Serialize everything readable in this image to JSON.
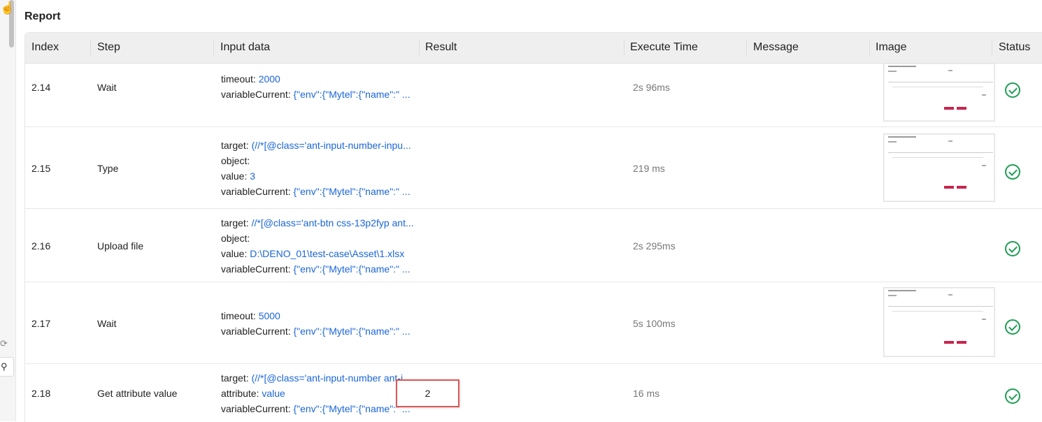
{
  "report_title": "Report",
  "columns": [
    "Index",
    "Step",
    "Input data",
    "Result",
    "Execute Time",
    "Message",
    "Image",
    "Status"
  ],
  "rows": [
    {
      "index": "2.14",
      "step": "Wait",
      "inputs": [
        {
          "key": "timeout:",
          "value": "2000"
        },
        {
          "key": "variableCurrent:",
          "value": "{\"env\":{\"Mytel\":{\"name\":\" ..."
        }
      ],
      "result": "",
      "execute_time": "2s 96ms",
      "message": "",
      "has_image": true,
      "status": "passed"
    },
    {
      "index": "2.15",
      "step": "Type",
      "inputs": [
        {
          "key": "target:",
          "value": "(//*[@class='ant-input-number-inpu..."
        },
        {
          "key": "object:",
          "value": ""
        },
        {
          "key": "value:",
          "value": "3"
        },
        {
          "key": "variableCurrent:",
          "value": "{\"env\":{\"Mytel\":{\"name\":\" ..."
        }
      ],
      "result": "",
      "execute_time": "219 ms",
      "message": "",
      "has_image": true,
      "status": "passed"
    },
    {
      "index": "2.16",
      "step": "Upload file",
      "inputs": [
        {
          "key": "target:",
          "value": "//*[@class='ant-btn css-13p2fyp ant..."
        },
        {
          "key": "object:",
          "value": ""
        },
        {
          "key": "value:",
          "value": "D:\\DENO_01\\test-case\\Asset\\1.xlsx"
        },
        {
          "key": "variableCurrent:",
          "value": "{\"env\":{\"Mytel\":{\"name\":\" ..."
        }
      ],
      "result": "",
      "execute_time": "2s 295ms",
      "message": "",
      "has_image": false,
      "status": "passed"
    },
    {
      "index": "2.17",
      "step": "Wait",
      "inputs": [
        {
          "key": "timeout:",
          "value": "5000"
        },
        {
          "key": "variableCurrent:",
          "value": "{\"env\":{\"Mytel\":{\"name\":\" ..."
        }
      ],
      "result": "",
      "execute_time": "5s 100ms",
      "message": "",
      "has_image": true,
      "status": "passed"
    },
    {
      "index": "2.18",
      "step": "Get attribute value",
      "inputs": [
        {
          "key": "target:",
          "value": "(//*[@class='ant-input-number ant-i..."
        },
        {
          "key": "attribute:",
          "value": "value"
        },
        {
          "key": "variableCurrent:",
          "value": "{\"env\":{\"Mytel\":{\"name\":\" ..."
        }
      ],
      "result": "2",
      "execute_time": "16 ms",
      "message": "",
      "has_image": false,
      "status": "passed"
    }
  ],
  "colors": {
    "link": "#1a66d9",
    "status_ok": "#1f9d55",
    "highlight": "#e05555"
  }
}
